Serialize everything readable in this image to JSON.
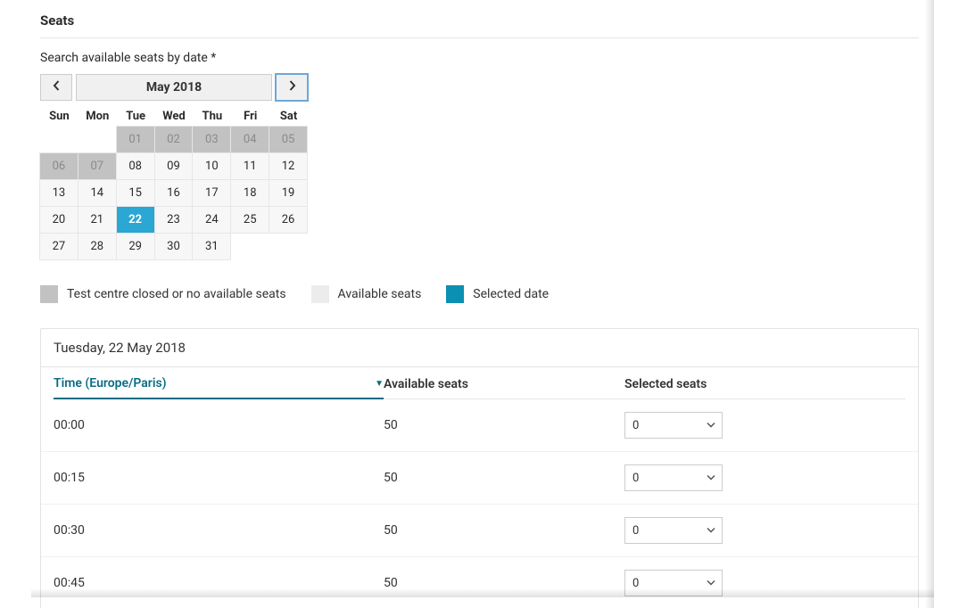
{
  "section_title": "Seats",
  "search_label": "Search available seats by date *",
  "calendar": {
    "month_label": "May 2018",
    "dow": [
      "Sun",
      "Mon",
      "Tue",
      "Wed",
      "Thu",
      "Fri",
      "Sat"
    ],
    "cells": [
      {
        "label": "",
        "state": "empty"
      },
      {
        "label": "",
        "state": "empty"
      },
      {
        "label": "01",
        "state": "closed"
      },
      {
        "label": "02",
        "state": "closed"
      },
      {
        "label": "03",
        "state": "closed"
      },
      {
        "label": "04",
        "state": "closed"
      },
      {
        "label": "05",
        "state": "closed"
      },
      {
        "label": "06",
        "state": "closed"
      },
      {
        "label": "07",
        "state": "closed"
      },
      {
        "label": "08",
        "state": "available"
      },
      {
        "label": "09",
        "state": "available"
      },
      {
        "label": "10",
        "state": "available"
      },
      {
        "label": "11",
        "state": "available"
      },
      {
        "label": "12",
        "state": "available"
      },
      {
        "label": "13",
        "state": "available"
      },
      {
        "label": "14",
        "state": "available"
      },
      {
        "label": "15",
        "state": "available"
      },
      {
        "label": "16",
        "state": "available"
      },
      {
        "label": "17",
        "state": "available"
      },
      {
        "label": "18",
        "state": "available"
      },
      {
        "label": "19",
        "state": "available"
      },
      {
        "label": "20",
        "state": "available"
      },
      {
        "label": "21",
        "state": "available"
      },
      {
        "label": "22",
        "state": "selected"
      },
      {
        "label": "23",
        "state": "available"
      },
      {
        "label": "24",
        "state": "available"
      },
      {
        "label": "25",
        "state": "available"
      },
      {
        "label": "26",
        "state": "available"
      },
      {
        "label": "27",
        "state": "available"
      },
      {
        "label": "28",
        "state": "available"
      },
      {
        "label": "29",
        "state": "available"
      },
      {
        "label": "30",
        "state": "available"
      },
      {
        "label": "31",
        "state": "available"
      }
    ]
  },
  "legend": {
    "closed": {
      "label": "Test centre closed or no available seats",
      "color": "#c2c2c2"
    },
    "available": {
      "label": "Available seats",
      "color": "#ececec"
    },
    "selected": {
      "label": "Selected date",
      "color": "#0b90b3"
    }
  },
  "panel": {
    "date_heading": "Tuesday, 22 May 2018",
    "columns": {
      "time": "Time (Europe/Paris)",
      "available": "Available seats",
      "selected": "Selected seats"
    },
    "slots": [
      {
        "time": "00:00",
        "available": "50",
        "selected": "0"
      },
      {
        "time": "00:15",
        "available": "50",
        "selected": "0"
      },
      {
        "time": "00:30",
        "available": "50",
        "selected": "0"
      },
      {
        "time": "00:45",
        "available": "50",
        "selected": "0"
      }
    ]
  }
}
